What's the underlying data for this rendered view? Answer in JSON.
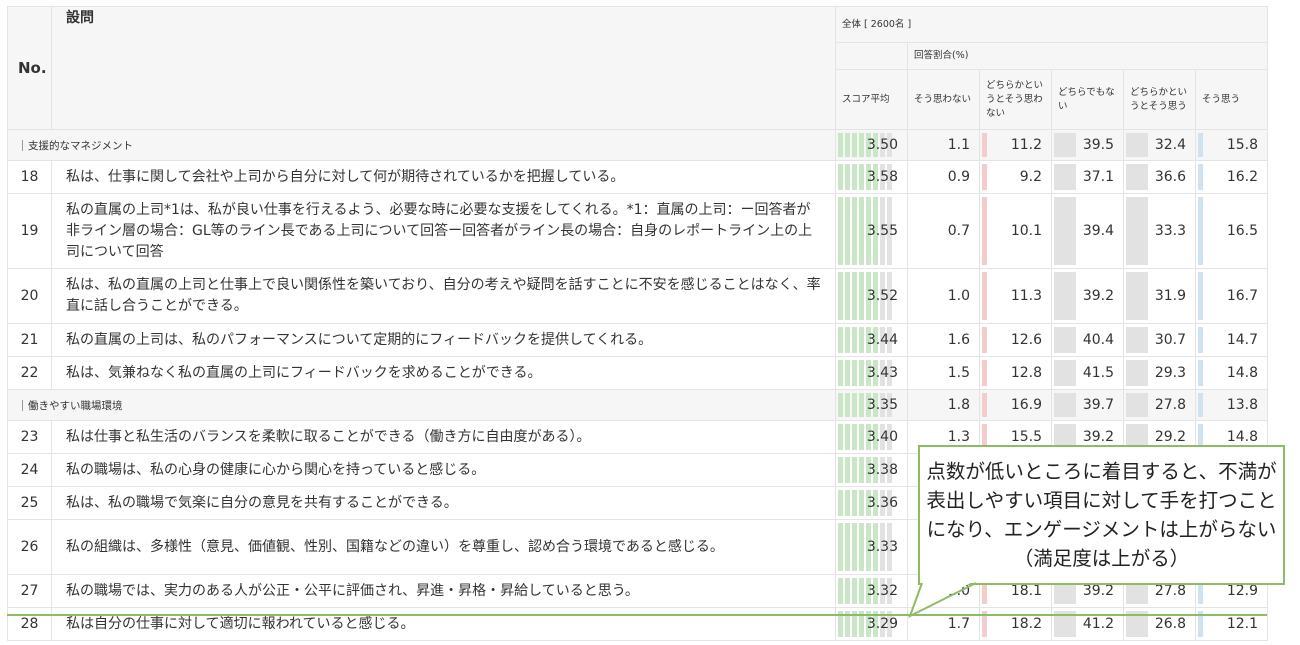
{
  "header": {
    "no": "No.",
    "question": "設問",
    "total": "全体 [ 2600名 ]",
    "ratio": "回答割合(%)",
    "score_avg": "スコア平均",
    "c1": "そう思わない",
    "c2": "どちらかというとそう思わない",
    "c3": "どちらでもない",
    "c4": "どちらかというとそう思う",
    "c5": "そう思う"
  },
  "sections": [
    {
      "label": "支援的なマネジメント",
      "score": "3.50",
      "vals": [
        "1.1",
        "11.2",
        "39.5",
        "32.4",
        "15.8"
      ],
      "rows": [
        {
          "no": "18",
          "q": "私は、仕事に関して会社や上司から自分に対して何が期待されているかを把握している。",
          "score": "3.58",
          "vals": [
            "0.9",
            "9.2",
            "37.1",
            "36.6",
            "16.2"
          ]
        },
        {
          "no": "19",
          "q": "私の直属の上司*1は、私が良い仕事を行えるよう、必要な時に必要な支援をしてくれる。*1：直属の上司：ー回答者が非ライン層の場合：GL等のライン長である上司について回答ー回答者がライン長の場合：自身のレポートライン上の上司について回答",
          "score": "3.55",
          "vals": [
            "0.7",
            "10.1",
            "39.4",
            "33.3",
            "16.5"
          ]
        },
        {
          "no": "20",
          "q": "私は、私の直属の上司と仕事上で良い関係性を築いており、自分の考えや疑問を話すことに不安を感じることはなく、率直に話し合うことができる。",
          "score": "3.52",
          "vals": [
            "1.0",
            "11.3",
            "39.2",
            "31.9",
            "16.7"
          ]
        },
        {
          "no": "21",
          "q": "私の直属の上司は、私のパフォーマンスについて定期的にフィードバックを提供してくれる。",
          "score": "3.44",
          "vals": [
            "1.6",
            "12.6",
            "40.4",
            "30.7",
            "14.7"
          ]
        },
        {
          "no": "22",
          "q": "私は、気兼ねなく私の直属の上司にフィードバックを求めることができる。",
          "score": "3.43",
          "vals": [
            "1.5",
            "12.8",
            "41.5",
            "29.3",
            "14.8"
          ]
        }
      ]
    },
    {
      "label": "働きやすい職場環境",
      "score": "3.35",
      "vals": [
        "1.8",
        "16.9",
        "39.7",
        "27.8",
        "13.8"
      ],
      "rows": [
        {
          "no": "23",
          "q": "私は仕事と私生活のバランスを柔軟に取ることができる（働き方に自由度がある）。",
          "score": "3.40",
          "vals": [
            "1.3",
            "15.5",
            "39.2",
            "29.2",
            "14.8"
          ]
        },
        {
          "no": "24",
          "q": "私の職場は、私の心身の健康に心から関心を持っていると感じる。",
          "score": "3.38",
          "vals": [
            "",
            "",
            "",
            "",
            ""
          ]
        },
        {
          "no": "25",
          "q": "私は、私の職場で気楽に自分の意見を共有することができる。",
          "score": "3.36",
          "vals": [
            "",
            "",
            "",
            "",
            ""
          ]
        },
        {
          "no": "26",
          "q": "私の組織は、多様性（意見、価値観、性別、国籍などの違い）を尊重し、認め合う環境であると感じる。",
          "score": "3.33",
          "vals": [
            "",
            "",
            "",
            "",
            ""
          ]
        },
        {
          "no": "27",
          "q": "私の職場では、実力のある人が公正・公平に評価され、昇進・昇格・昇給していると思う。",
          "score": "3.32",
          "vals": [
            "2.0",
            "18.1",
            "39.2",
            "27.8",
            "12.9"
          ]
        },
        {
          "no": "28",
          "q": "私は自分の仕事に対して適切に報われていると感じる。",
          "score": "3.29",
          "vals": [
            "1.7",
            "18.2",
            "41.2",
            "26.8",
            "12.1"
          ]
        }
      ]
    }
  ],
  "annotation": {
    "line1": "点数が低いところに着目すると、不満が",
    "line2": "表出しやすい項目に対して手を打つこと",
    "line3": "になり、エンゲージメントは上がらない",
    "line4": "（満足度は上がる）"
  },
  "colors": {
    "score_bar": "#c9e6c6",
    "neg_bar": "#f5cccc",
    "neutral_bar": "#e2e2e2",
    "pos_bar": "#cfe2f0",
    "callout_border": "#8bbd63"
  }
}
